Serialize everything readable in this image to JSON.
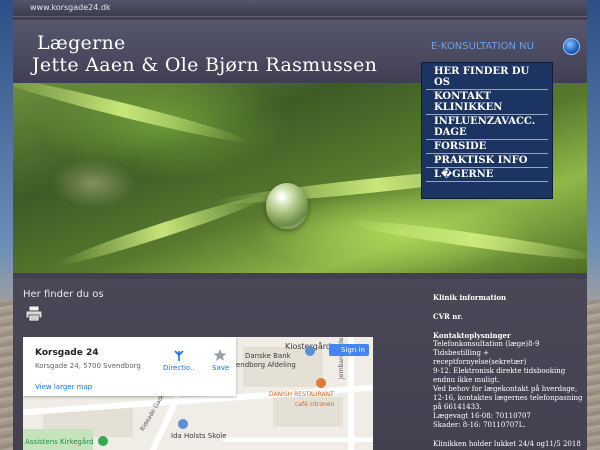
{
  "site": {
    "url": "www.korsgade24.dk"
  },
  "header": {
    "title_line1": "Lægerne",
    "title_line2": "Jette Aaen & Ole Bjørn Rasmussen",
    "ekonsultation_label": "E-KONSULTATION NU"
  },
  "nav": {
    "items": [
      {
        "label": "HER FINDER DU OS"
      },
      {
        "label": "KONTAKT KLINIKKEN"
      },
      {
        "label": "INFLUENZAVACC. DAGE"
      },
      {
        "label": "FORSIDE"
      },
      {
        "label": "PRAKTISK INFO"
      },
      {
        "label": "L�GERNE"
      }
    ]
  },
  "content": {
    "breadcrumb": "Her finder du os"
  },
  "map": {
    "card": {
      "title": "Korsgade 24",
      "address": "Korsgade 24, 5700 Svendborg",
      "larger_map_link": "View larger map",
      "directions_label": "Directio..",
      "save_label": "Save"
    },
    "signin_label": "Sign in",
    "labels": {
      "klostergard": "Klostergård",
      "danske_bank": "Danske Bank",
      "svendborg_afdeling": "endborg Afdeling",
      "danish_restaurant": "DANISH RESTAURANT",
      "cafe_citronen": "café citronen",
      "jernbanegade": "Jernbanegade",
      "ida_holsts_skole": "Ida Holsts Skole",
      "assistens_kirkegard": "Assistens Kirkegård",
      "riddergade": "Rideade Gade"
    }
  },
  "sidebar": {
    "klinik_header": "Klinik information",
    "cvr_label": "CVR nr.",
    "kontakt_header": "Kontaktoplysninger",
    "lines": [
      "Telefonkonsultation (læge)8-9",
      "Tidsbestilling + receptfornyelse(sekretær)",
      "9-12. Elektronisk direkte tidsbooking",
      "endnu ikke muligt.",
      "Ved behov for lægekontakt på hverdage,",
      "12-16, kontaktes lægernes telefonpasning",
      "på 66141433.",
      "Lægevagt 16-08: 70110707",
      "Skader: 8-16: 70110707L."
    ],
    "holiday_note": "Klinikken holder lukket  24/4 og11/5 2018"
  },
  "colors": {
    "nav_bg": "#1c3461",
    "frame_bg": "#42404f",
    "ekonsultation": "#6aa0e6",
    "map_link": "#1a73e8"
  },
  "icons": {
    "print": "printer-icon",
    "ekonsultation": "globe-icon",
    "directions": "directions-icon",
    "save": "star-icon"
  }
}
